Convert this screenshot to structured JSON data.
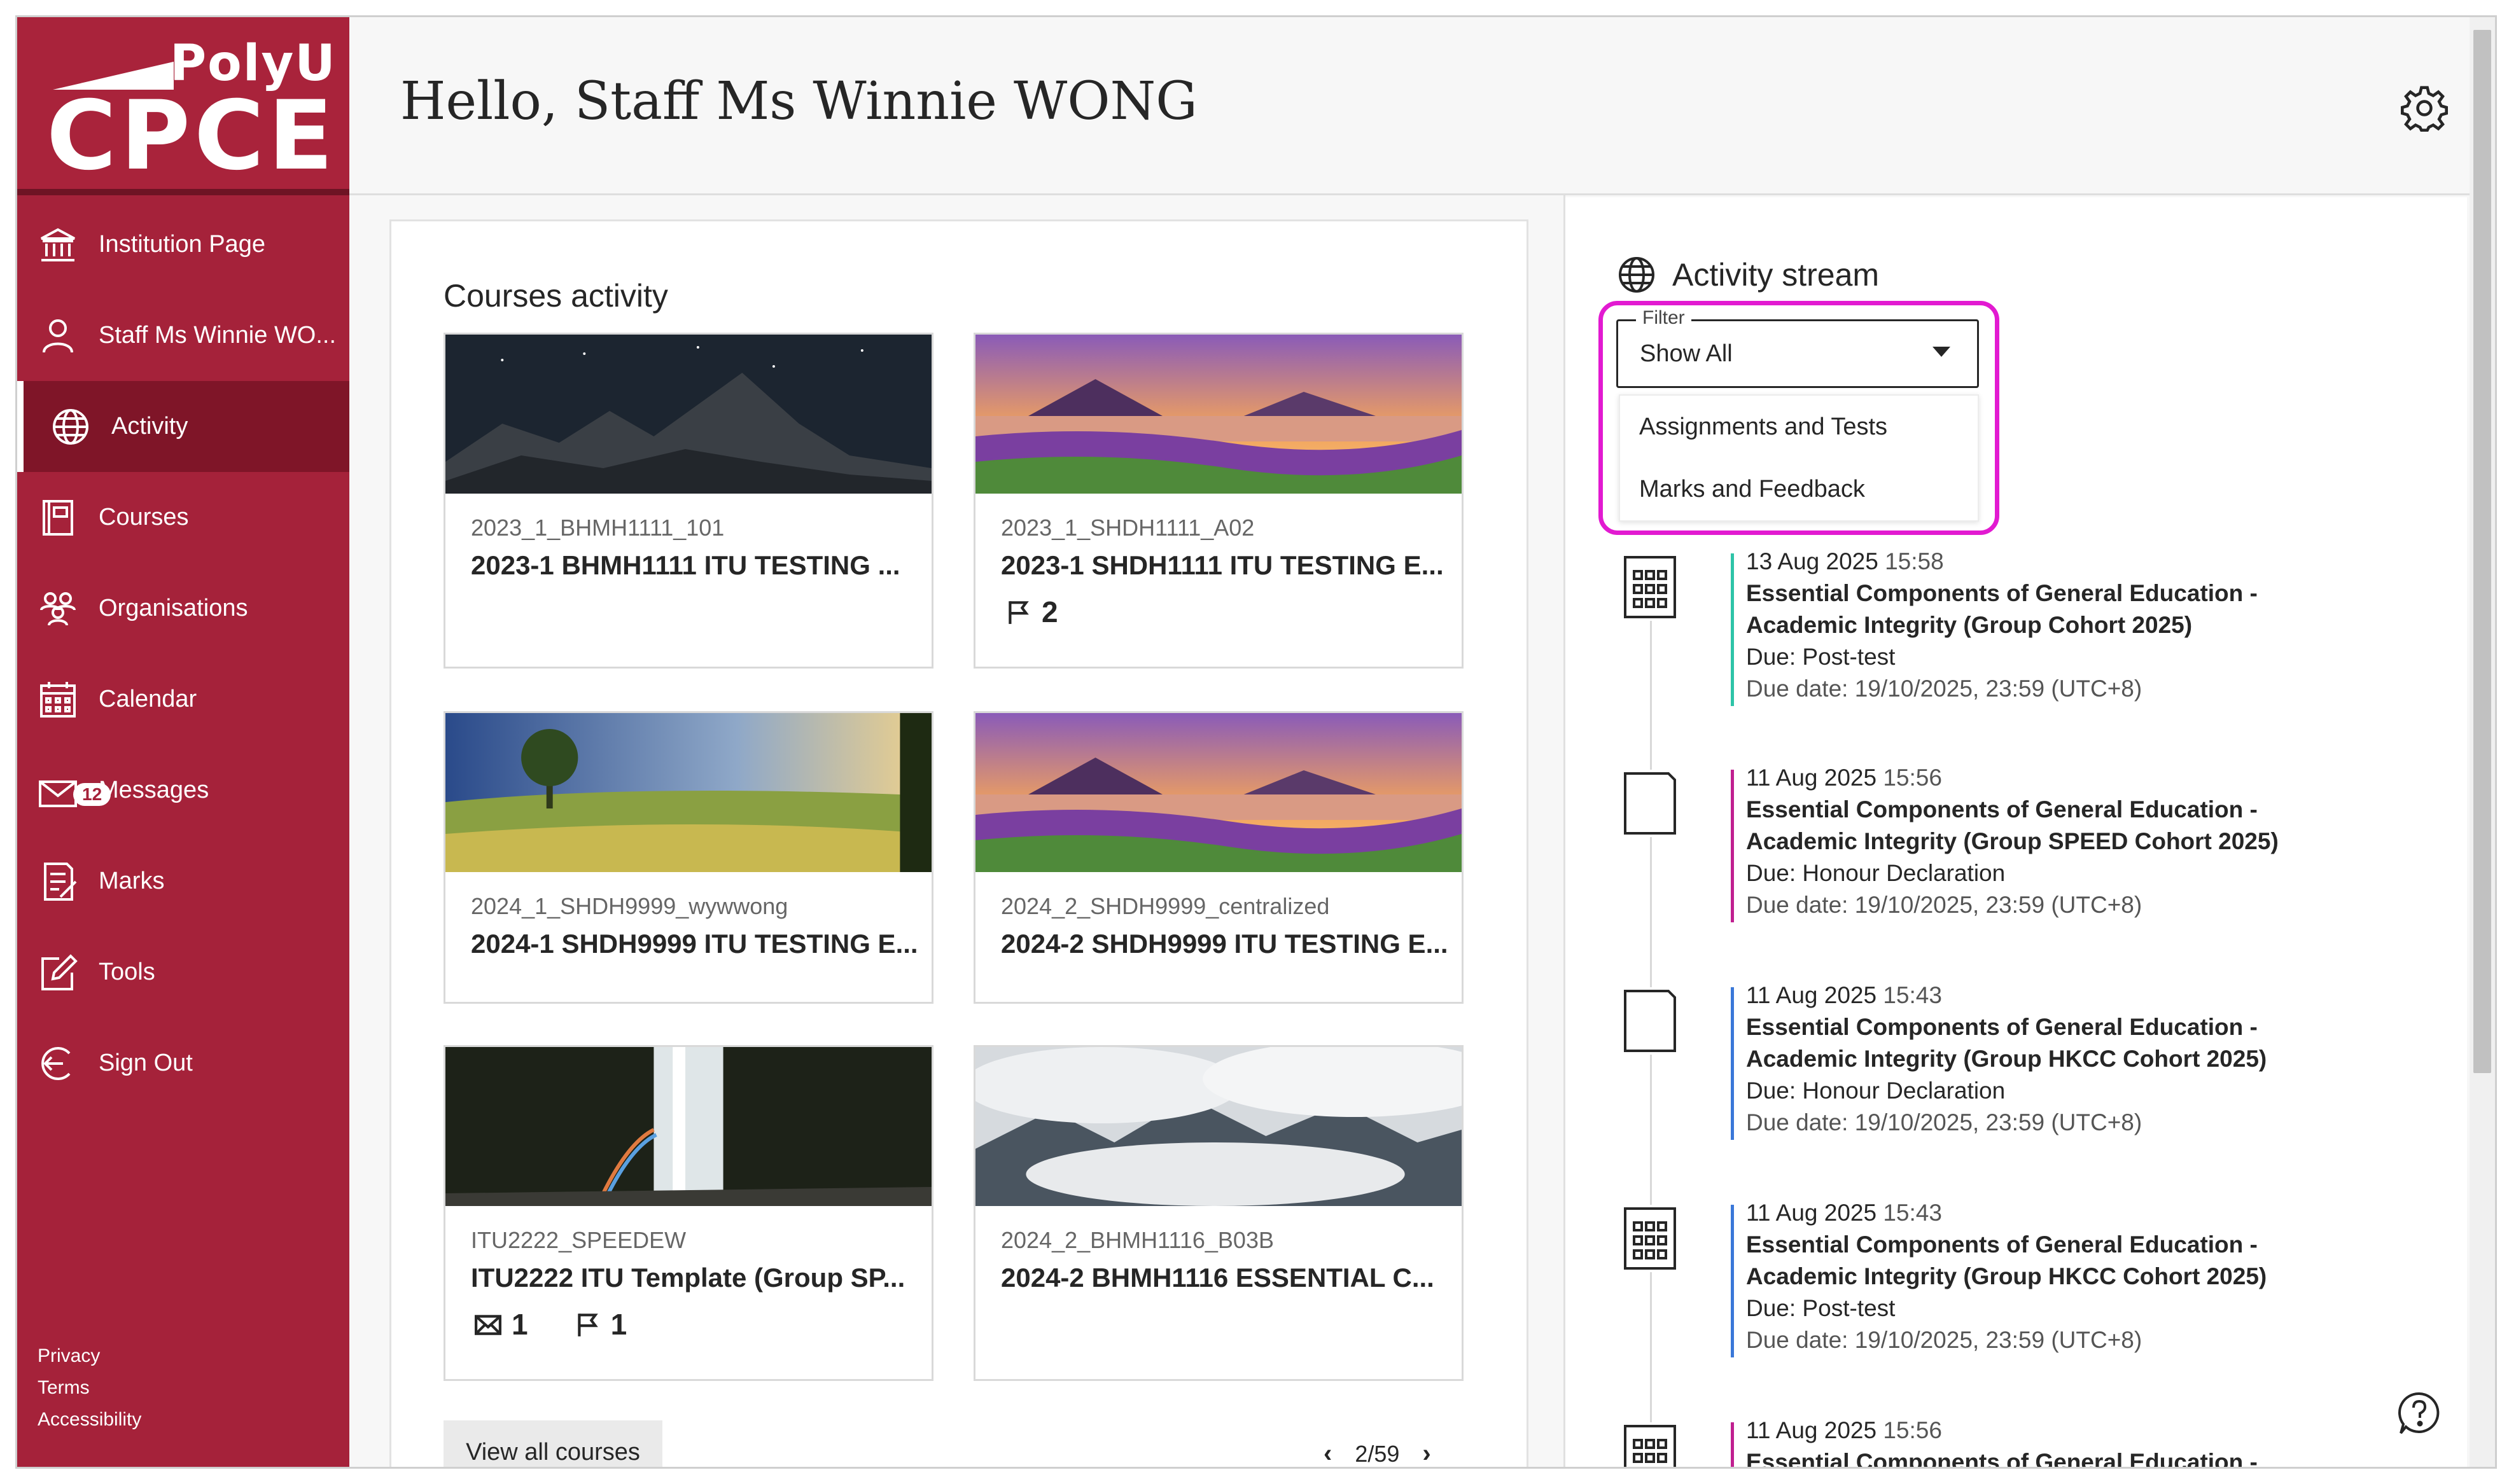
{
  "colors": {
    "brand": "#a5223a",
    "brand_dark": "#7f1528",
    "highlight": "#e21ad1"
  },
  "logo": {
    "line1": "PolyU",
    "line2": "CPCE"
  },
  "sidebar": {
    "items": [
      {
        "label": "Institution Page",
        "icon": "institution-icon"
      },
      {
        "label": "Staff Ms Winnie WO...",
        "icon": "user-icon"
      },
      {
        "label": "Activity",
        "icon": "globe-icon",
        "active": true
      },
      {
        "label": "Courses",
        "icon": "courses-icon"
      },
      {
        "label": "Organisations",
        "icon": "organisations-icon"
      },
      {
        "label": "Calendar",
        "icon": "calendar-icon"
      },
      {
        "label": "Messages",
        "icon": "envelope-icon",
        "badge": "12"
      },
      {
        "label": "Marks",
        "icon": "marks-icon"
      },
      {
        "label": "Tools",
        "icon": "tools-icon"
      },
      {
        "label": "Sign Out",
        "icon": "sign-out-icon"
      }
    ],
    "legal": [
      "Privacy",
      "Terms",
      "Accessibility"
    ]
  },
  "header": {
    "greeting": "Hello, Staff Ms Winnie WONG"
  },
  "courses": {
    "title": "Courses activity",
    "cards": [
      {
        "code": "2023_1_BHMH1111_101",
        "title": "2023-1 BHMH1111 ITU TESTING ...",
        "image": "night-mountain"
      },
      {
        "code": "2023_1_SHDH1111_A02",
        "title": "2023-1 SHDH1111 ITU TESTING E...",
        "image": "lake-flowers",
        "flags": "2"
      },
      {
        "code": "2024_1_SHDH9999_wywwong",
        "title": "2024-1 SHDH9999 ITU TESTING E...",
        "image": "meadow"
      },
      {
        "code": "2024_2_SHDH9999_centralized",
        "title": "2024-2 SHDH9999 ITU TESTING E...",
        "image": "lake-flowers"
      },
      {
        "code": "ITU2222_SPEEDEW",
        "title": "ITU2222 ITU Template (Group SP...",
        "image": "waterfall",
        "messages": "1",
        "flags": "1"
      },
      {
        "code": "2024_2_BHMH1116_B03B",
        "title": "2024-2 BHMH1116 ESSENTIAL C...",
        "image": "clouds-mountain"
      }
    ],
    "view_all": "View all courses",
    "pager": "2/59"
  },
  "stream": {
    "title": "Activity stream",
    "filter": {
      "legend": "Filter",
      "value": "Show All",
      "options": [
        "Assignments and Tests",
        "Marks and Feedback"
      ]
    },
    "events": [
      {
        "date": "13 Aug 2025",
        "time": "15:58",
        "name1": "Essential Components of General Education -",
        "name2": "Academic Integrity (Group Cohort 2025)",
        "due": "Due: Post-test",
        "due_date": "Due date: 19/10/2025, 23:59 (UTC+8)",
        "icon": "test-icon",
        "bar": "#2ec4a8"
      },
      {
        "date": "11 Aug 2025",
        "time": "15:56",
        "name1": "Essential Components of General Education -",
        "name2": "Academic Integrity (Group SPEED Cohort 2025)",
        "due": "Due: Honour Declaration",
        "due_date": "Due date: 19/10/2025, 23:59 (UTC+8)",
        "icon": "assignment-icon",
        "bar": "#c02090"
      },
      {
        "date": "11 Aug 2025",
        "time": "15:43",
        "name1": "Essential Components of General Education -",
        "name2": "Academic Integrity (Group HKCC Cohort 2025)",
        "due": "Due: Honour Declaration",
        "due_date": "Due date: 19/10/2025, 23:59 (UTC+8)",
        "icon": "assignment-icon",
        "bar": "#3a78d8"
      },
      {
        "date": "11 Aug 2025",
        "time": "15:43",
        "name1": "Essential Components of General Education -",
        "name2": "Academic Integrity (Group HKCC Cohort 2025)",
        "due": "Due: Post-test",
        "due_date": "Due date: 19/10/2025, 23:59 (UTC+8)",
        "icon": "test-icon",
        "bar": "#3a78d8"
      },
      {
        "date": "11 Aug 2025",
        "time": "15:56",
        "name1": "Essential Components of General Education -",
        "icon": "test-icon",
        "bar": "#c02090"
      }
    ]
  }
}
